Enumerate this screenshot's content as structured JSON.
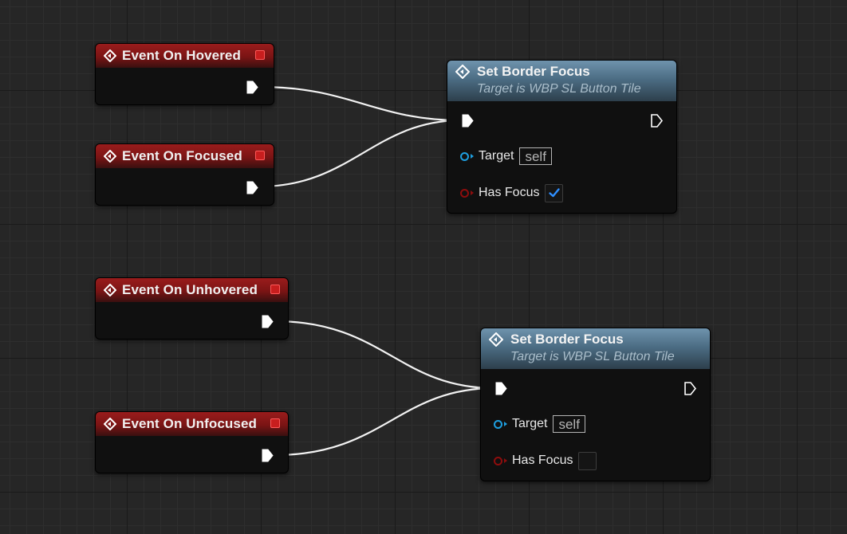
{
  "graph": {
    "event_nodes": [
      {
        "title": "Event On Hovered"
      },
      {
        "title": "Event On Focused"
      },
      {
        "title": "Event On Unhovered"
      },
      {
        "title": "Event On Unfocused"
      }
    ],
    "function_nodes": [
      {
        "title": "Set Border Focus",
        "subtitle": "Target is WBP SL Button Tile",
        "target_label": "Target",
        "target_value": "self",
        "has_focus_label": "Has Focus",
        "has_focus_checked": true
      },
      {
        "title": "Set Border Focus",
        "subtitle": "Target is WBP SL Button Tile",
        "target_label": "Target",
        "target_value": "self",
        "has_focus_label": "Has Focus",
        "has_focus_checked": false
      }
    ]
  },
  "colors": {
    "event_header": "#8a1a1a",
    "function_header": "#5a7d96",
    "exec_wire": "#f2f2f2",
    "object_pin": "#1e9fe0",
    "bool_pin": "#8e0d0d",
    "delegate_pin": "#ff5a5a",
    "checkmark": "#2f8fff"
  }
}
